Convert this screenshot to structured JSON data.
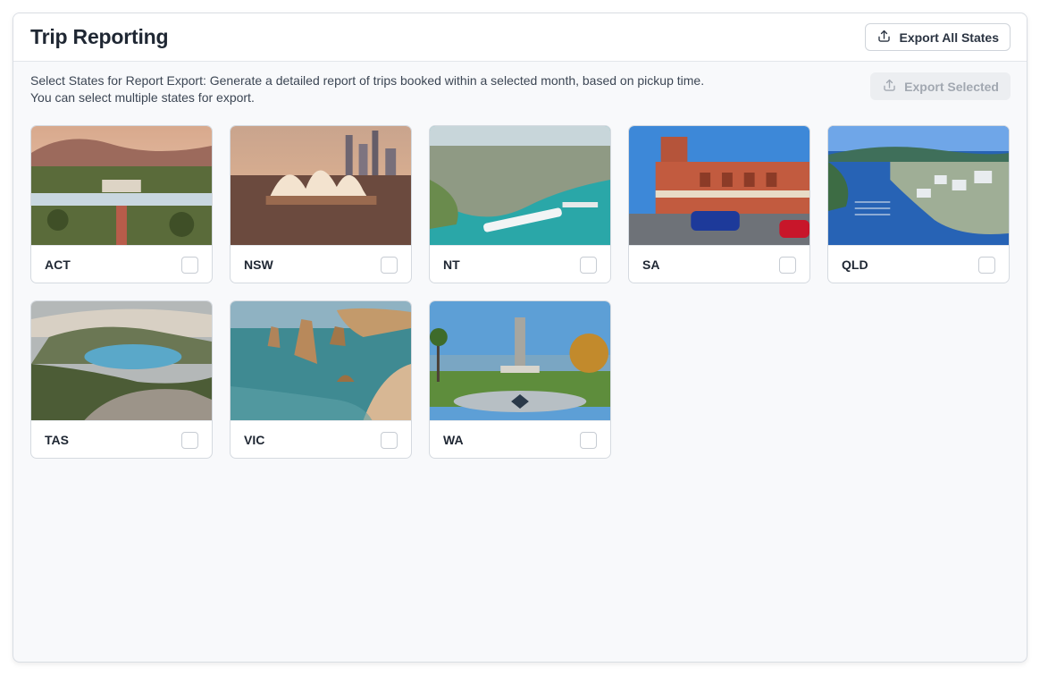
{
  "header": {
    "title": "Trip Reporting",
    "export_all_label": "Export All States"
  },
  "description": {
    "line1": "Select States for Report Export: Generate a detailed report of trips booked within a selected month, based on pickup time.",
    "line2": "You can select multiple states for export."
  },
  "export_selected_label": "Export Selected",
  "states": [
    {
      "label": "ACT",
      "checked": false
    },
    {
      "label": "NSW",
      "checked": false
    },
    {
      "label": "NT",
      "checked": false
    },
    {
      "label": "SA",
      "checked": false
    },
    {
      "label": "QLD",
      "checked": false
    },
    {
      "label": "TAS",
      "checked": false
    },
    {
      "label": "VIC",
      "checked": false
    },
    {
      "label": "WA",
      "checked": false
    }
  ],
  "colors": {
    "accent_text": "#1f2733",
    "disabled_text": "#a2a8b1",
    "panel_bg": "#f8f9fb"
  }
}
